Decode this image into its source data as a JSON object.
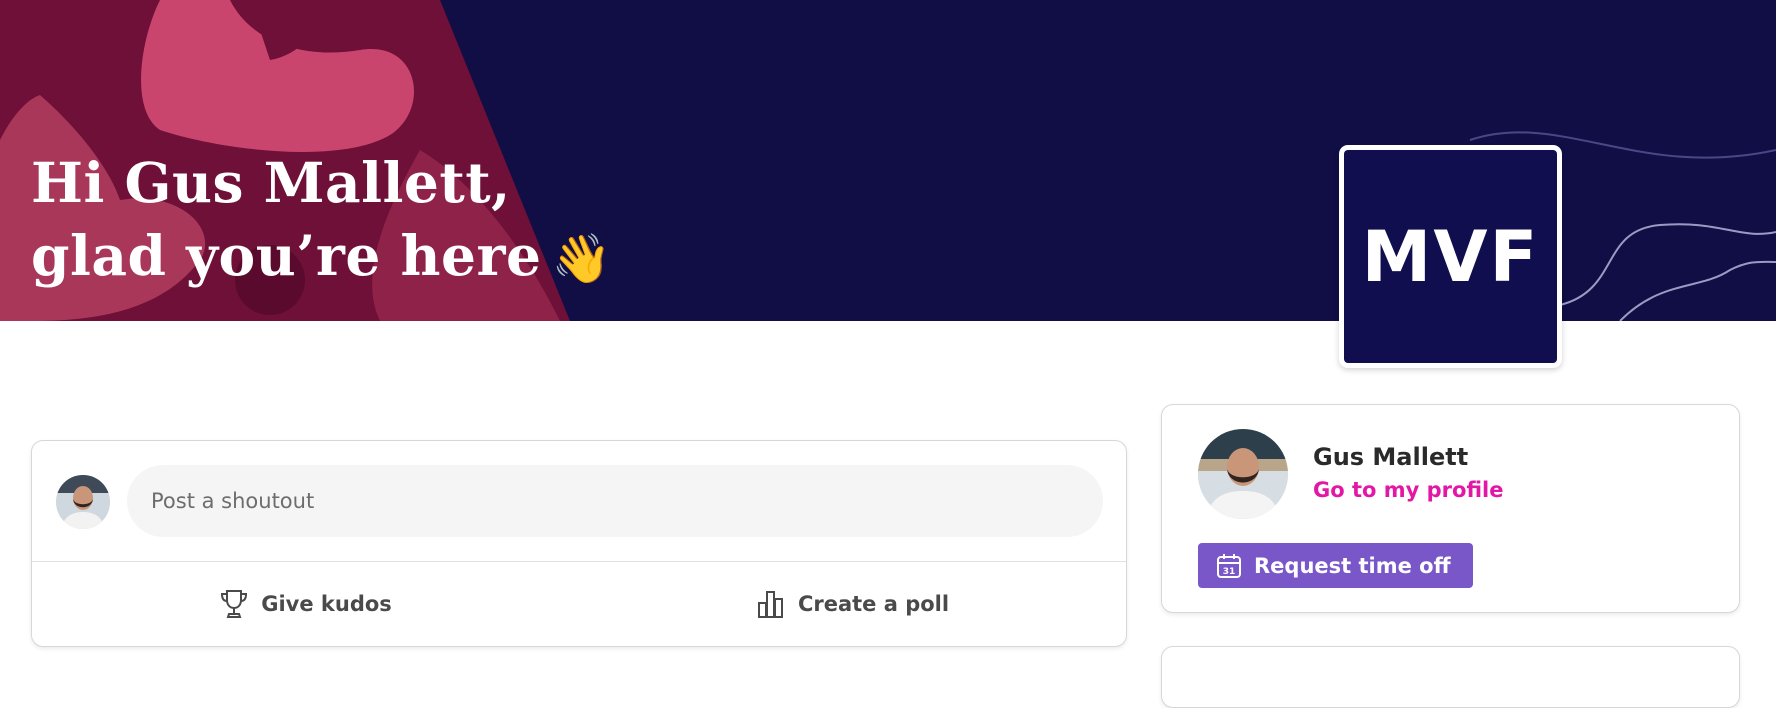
{
  "banner": {
    "greeting_line1": "Hi Gus Mallett,",
    "greeting_line2": "glad you’re here",
    "wave_emoji": "👋",
    "background_color": "#100e45",
    "accent_color": "#6e1037"
  },
  "company_logo": {
    "text": "MVF",
    "background_color": "#100e4e"
  },
  "shoutout": {
    "placeholder": "Post a shoutout",
    "value": "",
    "give_kudos_label": "Give kudos",
    "give_kudos_icon": "trophy-icon",
    "create_poll_label": "Create a poll",
    "create_poll_icon": "bar-chart-icon"
  },
  "profile": {
    "name": "Gus Mallett",
    "link_label": "Go to my profile",
    "link_color": "#e317a6",
    "request_time_off_label": "Request time off",
    "request_time_off_icon": "calendar-icon",
    "button_color": "#7a57c9"
  }
}
